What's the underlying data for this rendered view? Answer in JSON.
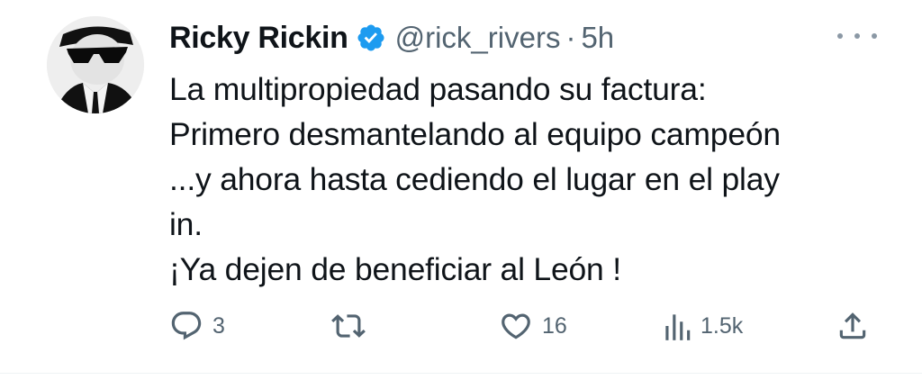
{
  "tweet": {
    "author": {
      "display_name": "Ricky Rickin",
      "handle": "@rick_rivers",
      "separator": "·",
      "time": "5h",
      "avatar_icon": "avatar-man-sunglasses",
      "verified_icon": "verified-badge-icon",
      "verified_color": "#1d9bf0"
    },
    "text_lines": [
      "La multipropiedad pasando su factura:",
      "Primero desmantelando al equipo campeón",
      "...y ahora hasta cediendo el lugar en el play",
      "in.",
      "¡Ya dejen de beneficiar al León !"
    ],
    "actions": {
      "reply": {
        "icon": "reply-icon",
        "count": "3"
      },
      "retweet": {
        "icon": "retweet-icon",
        "count": ""
      },
      "like": {
        "icon": "heart-icon",
        "count": "16"
      },
      "views": {
        "icon": "views-icon",
        "count": "1.5k"
      },
      "share": {
        "icon": "share-icon"
      }
    },
    "colors": {
      "text": "#0f1419",
      "secondary": "#536471",
      "verified": "#1d9bf0"
    }
  }
}
